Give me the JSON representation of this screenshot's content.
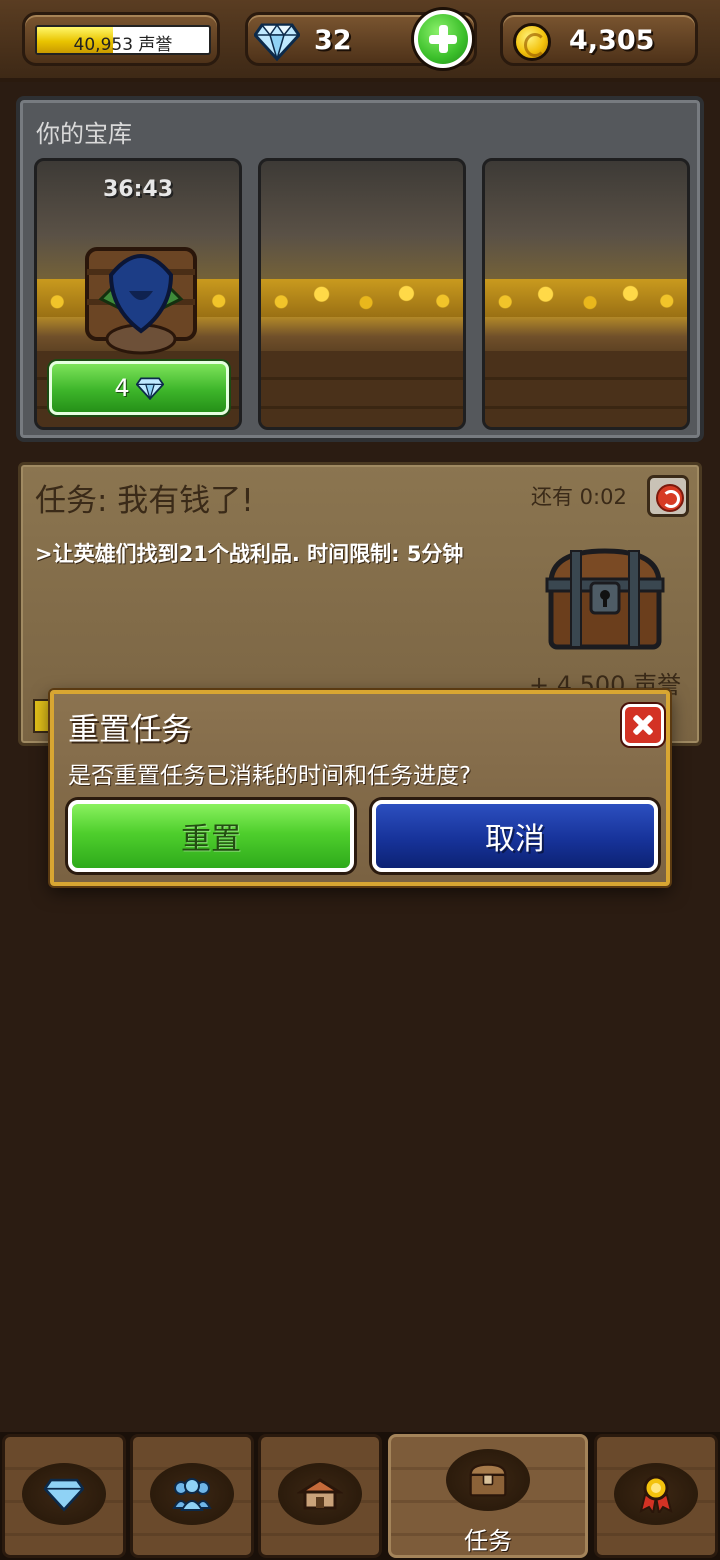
{
  "top_bar": {
    "reputation_text": "40,953 声誉",
    "reputation_progress": 0.44,
    "gems": "32",
    "gold": "4,305"
  },
  "vault": {
    "title": "你的宝库",
    "slots": [
      {
        "timer": "36:43",
        "button_label": "4"
      },
      {
        "timer": "",
        "button_label": ""
      },
      {
        "timer": "",
        "button_label": ""
      }
    ]
  },
  "quest": {
    "title": "任务: 我有钱了!",
    "time_left": "还有 0:02",
    "description": ">让英雄们找到21个战利品. 时间限制: 5分钟",
    "reward": "+ 4,500 声誉"
  },
  "dialog": {
    "title": "重置任务",
    "message": "是否重置任务已消耗的时间和任务进度?",
    "confirm_label": "重置",
    "cancel_label": "取消"
  },
  "bottom_nav": {
    "tabs": [
      {
        "icon": "gem-icon",
        "label": ""
      },
      {
        "icon": "heroes-icon",
        "label": ""
      },
      {
        "icon": "house-icon",
        "label": ""
      },
      {
        "icon": "chest-icon",
        "label": "任务"
      },
      {
        "icon": "medal-icon",
        "label": ""
      }
    ]
  },
  "colors": {
    "background": "#2b1c12",
    "accent_gold": "#d8a632",
    "confirm_green": "#4fcf2d",
    "cancel_blue": "#17339a"
  }
}
